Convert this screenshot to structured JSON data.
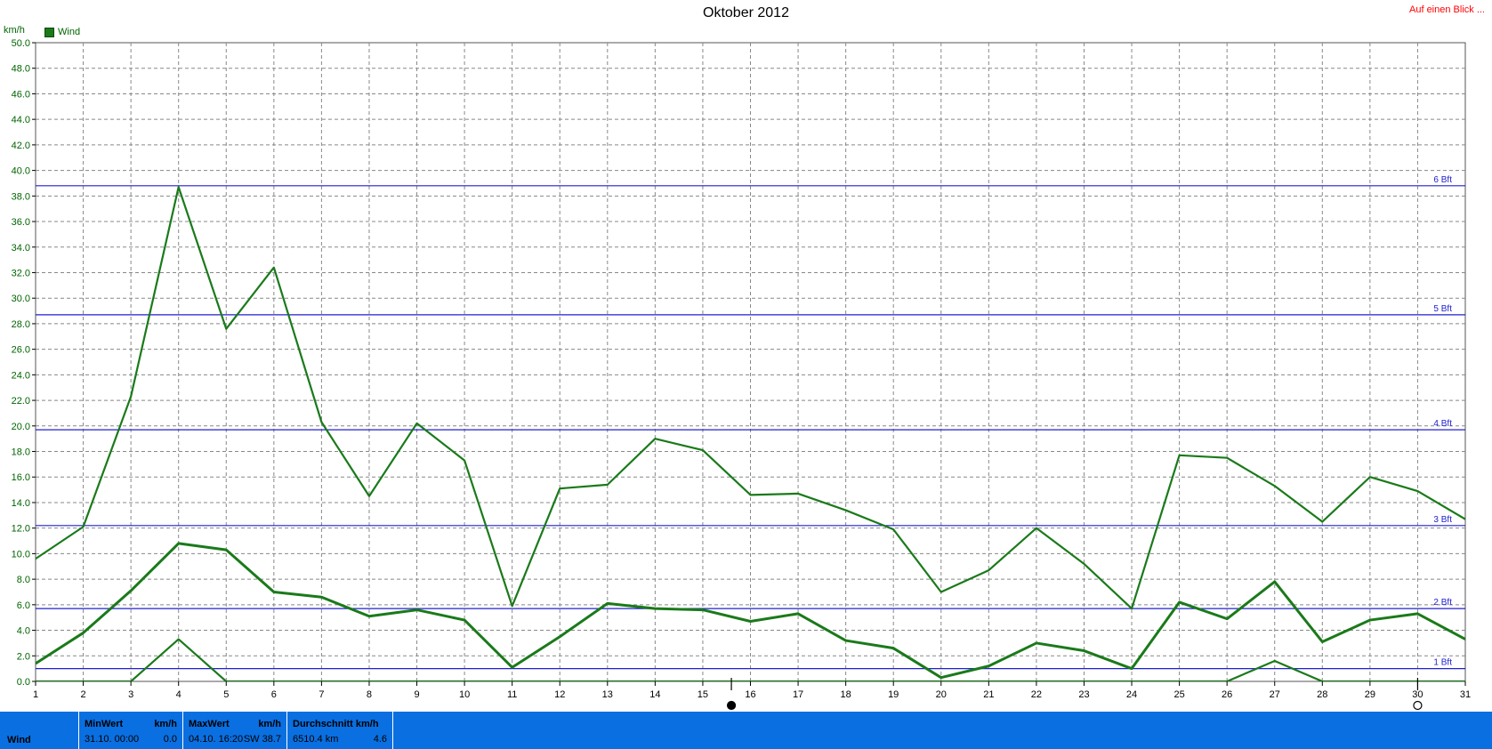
{
  "header": {
    "title": "Oktober 2012",
    "link": "Auf einen Blick ...",
    "y_unit": "km/h",
    "legend_label": "Wind"
  },
  "chart_data": {
    "type": "line",
    "title": "Oktober 2012",
    "ylabel": "km/h",
    "xlim": [
      1,
      31
    ],
    "ylim": [
      0,
      50
    ],
    "y_ticks": [
      "0.0",
      "2.0",
      "4.0",
      "6.0",
      "8.0",
      "10.0",
      "12.0",
      "14.0",
      "16.0",
      "18.0",
      "20.0",
      "22.0",
      "24.0",
      "26.0",
      "28.0",
      "30.0",
      "32.0",
      "34.0",
      "36.0",
      "38.0",
      "40.0",
      "42.0",
      "44.0",
      "46.0",
      "48.0",
      "50.0"
    ],
    "x": [
      1,
      2,
      3,
      4,
      5,
      6,
      7,
      8,
      9,
      10,
      11,
      12,
      13,
      14,
      15,
      16,
      17,
      18,
      19,
      20,
      21,
      22,
      23,
      24,
      25,
      26,
      27,
      28,
      29,
      30,
      31
    ],
    "legend": [
      "Wind"
    ],
    "grid": true,
    "series": [
      {
        "name": "Wind",
        "role": "max",
        "color": "#1a7a1a",
        "values": [
          9.6,
          12.1,
          22.3,
          38.7,
          27.6,
          32.4,
          20.3,
          14.5,
          20.2,
          17.3,
          5.9,
          15.1,
          15.4,
          19.0,
          18.1,
          14.6,
          14.7,
          13.4,
          11.9,
          7.0,
          8.7,
          12.0,
          9.2,
          5.7,
          17.7,
          17.5,
          15.3,
          12.5,
          16.0,
          14.9,
          12.7
        ]
      },
      {
        "name": "Wind",
        "role": "average",
        "color": "#1a7a1a",
        "values": [
          1.4,
          3.8,
          7.1,
          10.8,
          10.3,
          7.0,
          6.6,
          5.1,
          5.6,
          4.8,
          1.1,
          3.5,
          6.1,
          5.7,
          5.6,
          4.7,
          5.3,
          3.2,
          2.6,
          0.3,
          1.2,
          3.0,
          2.4,
          1.0,
          6.2,
          4.9,
          7.8,
          3.1,
          4.8,
          5.3,
          3.3
        ]
      },
      {
        "name": "Wind",
        "role": "min",
        "color": "#1a7a1a",
        "values": [
          0.0,
          0.0,
          0.0,
          3.3,
          0.0,
          0.0,
          0.0,
          0.0,
          0.0,
          0.0,
          0.0,
          0.0,
          0.0,
          0.0,
          0.0,
          0.0,
          0.0,
          0.0,
          0.0,
          0.0,
          0.0,
          0.0,
          0.0,
          0.0,
          0.0,
          0.0,
          1.6,
          0.0,
          0.0,
          0.0,
          0.0
        ]
      }
    ],
    "reference_lines": [
      {
        "label": "1 Bft",
        "value": 1.0
      },
      {
        "label": "2 Bft",
        "value": 5.7
      },
      {
        "label": "3 Bft",
        "value": 12.2
      },
      {
        "label": "4 Bft",
        "value": 19.7
      },
      {
        "label": "5 Bft",
        "value": 28.7
      },
      {
        "label": "6 Bft",
        "value": 38.8
      }
    ],
    "moon_markers": [
      {
        "day": 15.6,
        "phase": "new-moon"
      },
      {
        "day": 30.0,
        "phase": "full-moon"
      }
    ],
    "colors": {
      "series": "#1a7a1a",
      "reference": "#2020d0",
      "grid": "#888888",
      "footer": "#0a6fe0"
    }
  },
  "footer": {
    "row_label": "Wind",
    "min": {
      "header": "MinWert",
      "unit": "km/h",
      "date": "31.10.  00:00",
      "value": "0.0"
    },
    "max": {
      "header": "MaxWert",
      "unit": "km/h",
      "date": "04.10.  16:20",
      "value": "SW 38.7"
    },
    "avg": {
      "header": "Durchschnitt km/h",
      "distance": "6510.4 km",
      "value": "4.6"
    }
  }
}
